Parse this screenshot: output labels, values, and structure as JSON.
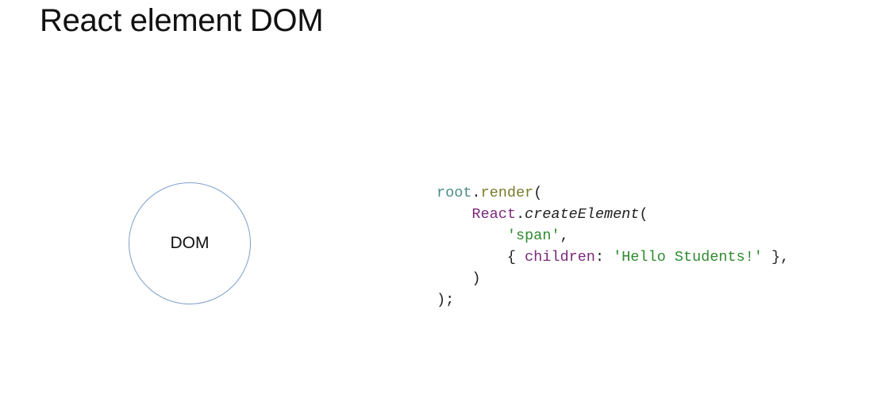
{
  "slide": {
    "title": "React element DOM"
  },
  "diagram": {
    "node_label": "DOM",
    "node_border_color": "#7f9fc7"
  },
  "code": {
    "lines": [
      {
        "tokens": [
          {
            "text": "root",
            "kind": "var"
          },
          {
            "text": ".",
            "kind": "punc"
          },
          {
            "text": "render",
            "kind": "fn"
          },
          {
            "text": "(",
            "kind": "punc"
          }
        ]
      },
      {
        "tokens": [
          {
            "text": "    ",
            "kind": "punc"
          },
          {
            "text": "React",
            "kind": "kw"
          },
          {
            "text": ".",
            "kind": "punc"
          },
          {
            "text": "createElement",
            "kind": "ital"
          },
          {
            "text": "(",
            "kind": "punc"
          }
        ]
      },
      {
        "tokens": [
          {
            "text": "        ",
            "kind": "punc"
          },
          {
            "text": "'span'",
            "kind": "str"
          },
          {
            "text": ",",
            "kind": "punc"
          }
        ]
      },
      {
        "tokens": [
          {
            "text": "        { ",
            "kind": "punc"
          },
          {
            "text": "children",
            "kind": "kw"
          },
          {
            "text": ": ",
            "kind": "punc"
          },
          {
            "text": "'Hello Students!'",
            "kind": "str"
          },
          {
            "text": " },",
            "kind": "punc"
          }
        ]
      },
      {
        "tokens": [
          {
            "text": "    )",
            "kind": "punc"
          }
        ]
      },
      {
        "tokens": [
          {
            "text": ");",
            "kind": "punc"
          }
        ]
      }
    ],
    "colors": {
      "var": "#4a8c86",
      "fn": "#7a7a2a",
      "kw": "#7a2a7a",
      "str": "#2f8a2f",
      "punc": "#222222"
    }
  }
}
